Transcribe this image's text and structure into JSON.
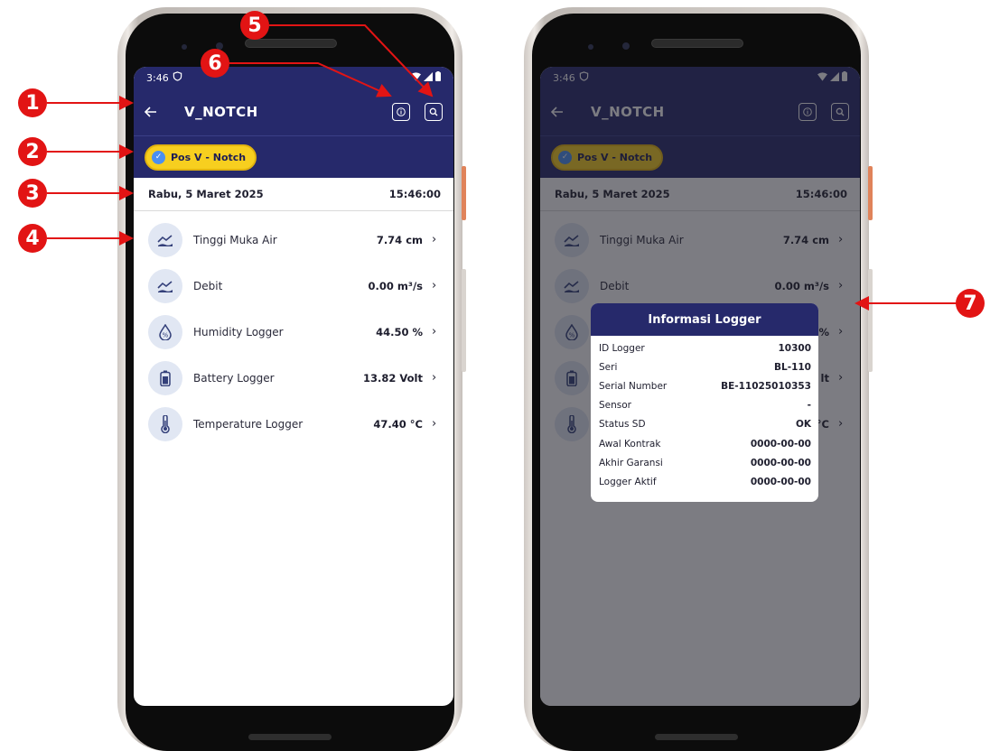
{
  "status_bar": {
    "time": "3:46",
    "left_icon": "vpn-shield-icon",
    "right_icons": [
      "wifi-icon",
      "signal-icon",
      "battery-icon"
    ]
  },
  "app_bar": {
    "title": "V_NOTCH",
    "back_icon": "back-arrow-icon",
    "info_icon": "info-icon",
    "search_icon": "search-icon"
  },
  "station_chip": {
    "label": "Pos V - Notch",
    "icon": "check-circle-icon"
  },
  "date_bar": {
    "date": "Rabu, 5 Maret 2025",
    "time": "15:46:00"
  },
  "sensors": [
    {
      "icon": "water-level-icon",
      "label": "Tinggi Muka Air",
      "value": "7.74 cm"
    },
    {
      "icon": "water-level-icon",
      "label": "Debit",
      "value": "0.00 m³/s"
    },
    {
      "icon": "humidity-drop-icon",
      "label": "Humidity Logger",
      "value": "44.50 %"
    },
    {
      "icon": "battery-icon",
      "label": "Battery Logger",
      "value": "13.82 Volt"
    },
    {
      "icon": "thermometer-icon",
      "label": "Temperature Logger",
      "value": "47.40 °C"
    }
  ],
  "sensors_partial": [
    "%",
    "lt",
    "°C"
  ],
  "dialog": {
    "title": "Informasi Logger",
    "rows": [
      {
        "label": "ID Logger",
        "value": "10300"
      },
      {
        "label": "Seri",
        "value": "BL-110"
      },
      {
        "label": "Serial Number",
        "value": "BE-11025010353"
      },
      {
        "label": "Sensor",
        "value": "-"
      },
      {
        "label": "Status SD",
        "value": "OK"
      },
      {
        "label": "Awal Kontrak",
        "value": "0000-00-00"
      },
      {
        "label": "Akhir Garansi",
        "value": "0000-00-00"
      },
      {
        "label": "Logger Aktif",
        "value": "0000-00-00"
      }
    ]
  },
  "callouts": [
    "1",
    "2",
    "3",
    "4",
    "5",
    "6",
    "7"
  ],
  "colors": {
    "primary": "#26296b",
    "accent": "#f7cf1f",
    "annotation": "#e21414"
  }
}
